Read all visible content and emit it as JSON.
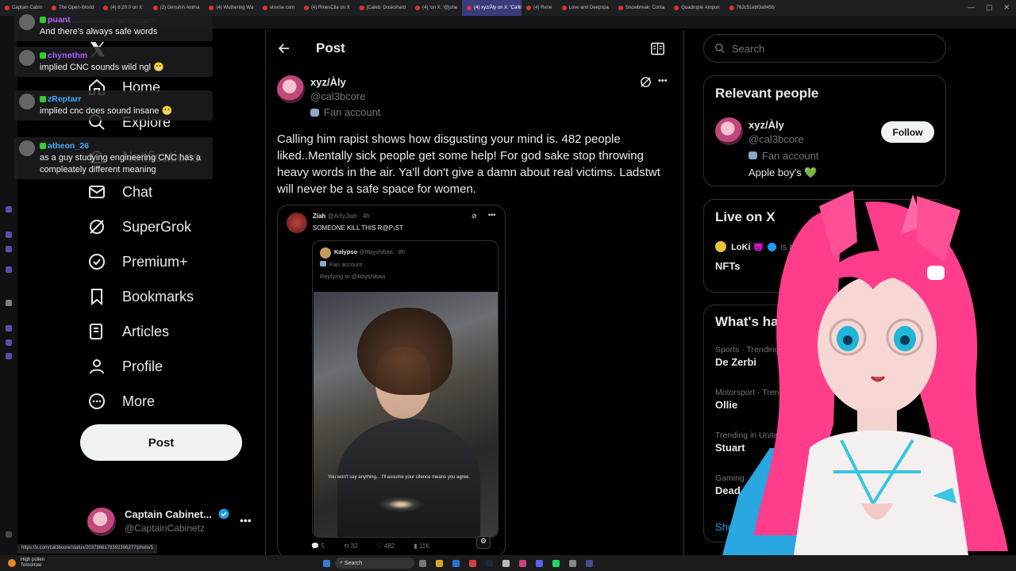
{
  "browser": {
    "tabs": [
      "Captain Cabin",
      "The Open-World",
      "(4) 8:20:0 on X: ",
      "(2) Genshin Anima",
      "(4) Wuthering Wa",
      "visvise.com",
      "(4) RinesCila on X",
      "[Caleb: Duskshard",
      "(4) 'on X: '@jshe",
      "(4) xyz/Àly on X: 'Calling",
      "(4) Rene",
      "Love and Deepspa",
      "Snowbreak: Conta",
      "Quadruple Ampun",
      "762c51ebf3a945b"
    ],
    "active_tab_index": 9,
    "url": "x.com/cal3bcore/status/2037966178392396277",
    "status_url": "https://x.com/cal3bcore/status/2037966178392396277/photo/1"
  },
  "chat": [
    {
      "name": "puant",
      "message": "And there's always safe words",
      "color": "#c061ff"
    },
    {
      "name": "chynothm",
      "message": "implied CNC sounds wild ngl 😬",
      "color": "#a55bff"
    },
    {
      "name": "zReptarr",
      "message": "implied cnc does sound insane 😬",
      "color": "#3fa9ff"
    },
    {
      "name": "atheon_26",
      "message": "as a guy studying engineering CNC has a compleately different meaning",
      "color": "#3fa9ff"
    }
  ],
  "nav": {
    "items": [
      {
        "label": "Home",
        "icon": "home-icon"
      },
      {
        "label": "Explore",
        "icon": "search-icon"
      },
      {
        "label": "Notifications",
        "icon": "bell-icon"
      },
      {
        "label": "Chat",
        "icon": "mail-icon"
      },
      {
        "label": "SuperGrok",
        "icon": "grok-icon"
      },
      {
        "label": "Premium+",
        "icon": "verified-icon"
      },
      {
        "label": "Bookmarks",
        "icon": "bookmark-icon"
      },
      {
        "label": "Articles",
        "icon": "articles-icon"
      },
      {
        "label": "Profile",
        "icon": "profile-icon"
      },
      {
        "label": "More",
        "icon": "more-circle-icon"
      }
    ],
    "post_label": "Post",
    "account": {
      "name": "Captain Cabinet...",
      "handle": "@CaptainCabinetz"
    }
  },
  "main": {
    "header_title": "Post",
    "author": {
      "name": "xyz/Àly",
      "handle": "@cal3bcore",
      "badge": "Fan account"
    },
    "text": "Calling him rapist shows how disgusting your mind is. 482 people liked..Mentally sick people get some help! For god sake stop throwing heavy words in the air. Ya'll don't give a damn about real victims. Ladstwt will never be a safe space for women.",
    "quote": {
      "name": "Ziah",
      "handle": "@ArtyJiah",
      "time": "· 4h",
      "text": "SOMEONE KILL THIS R@P¡ST",
      "inner": {
        "name": "Kalypso",
        "handle": "@Bbyshibaa",
        "time": "· 8h",
        "badge": "Fan account",
        "reply": "Replying to @Bbyshibaa",
        "image_caption": "You won't say anything... I'll assume your silence means you agree."
      },
      "stats": {
        "replies": "5",
        "reposts": "32",
        "likes": "482",
        "views": "11K"
      }
    }
  },
  "right": {
    "search_placeholder": "Search",
    "relevant_title": "Relevant people",
    "person": {
      "name": "xyz/Àly",
      "handle": "@cal3bcore",
      "badge": "Fan account",
      "bio": "Apple boy's 💚",
      "follow_label": "Follow"
    },
    "live_title": "Live on X",
    "live": {
      "host": "LoKi 😈",
      "hosting_text": "is hosting",
      "topic": "NFTs"
    },
    "happening_title": "What's happening",
    "trends": [
      {
        "category": "Sports · Trending",
        "topic": "De Zerbi"
      },
      {
        "category": "Motorsport · Trending",
        "topic": "Ollie"
      },
      {
        "category": "Trending in United Kingdom",
        "topic": "Stuart"
      },
      {
        "category": "Gaming · Trending",
        "topic": "Dead by Daylight"
      }
    ],
    "show_more": "Show more"
  },
  "taskbar": {
    "weather_title": "High pollen",
    "weather_sub": "Tomorrow",
    "search_label": "Search"
  },
  "colors": {
    "accent": "#1d9bf0",
    "vtuber_hair": "#ff3d8b"
  }
}
